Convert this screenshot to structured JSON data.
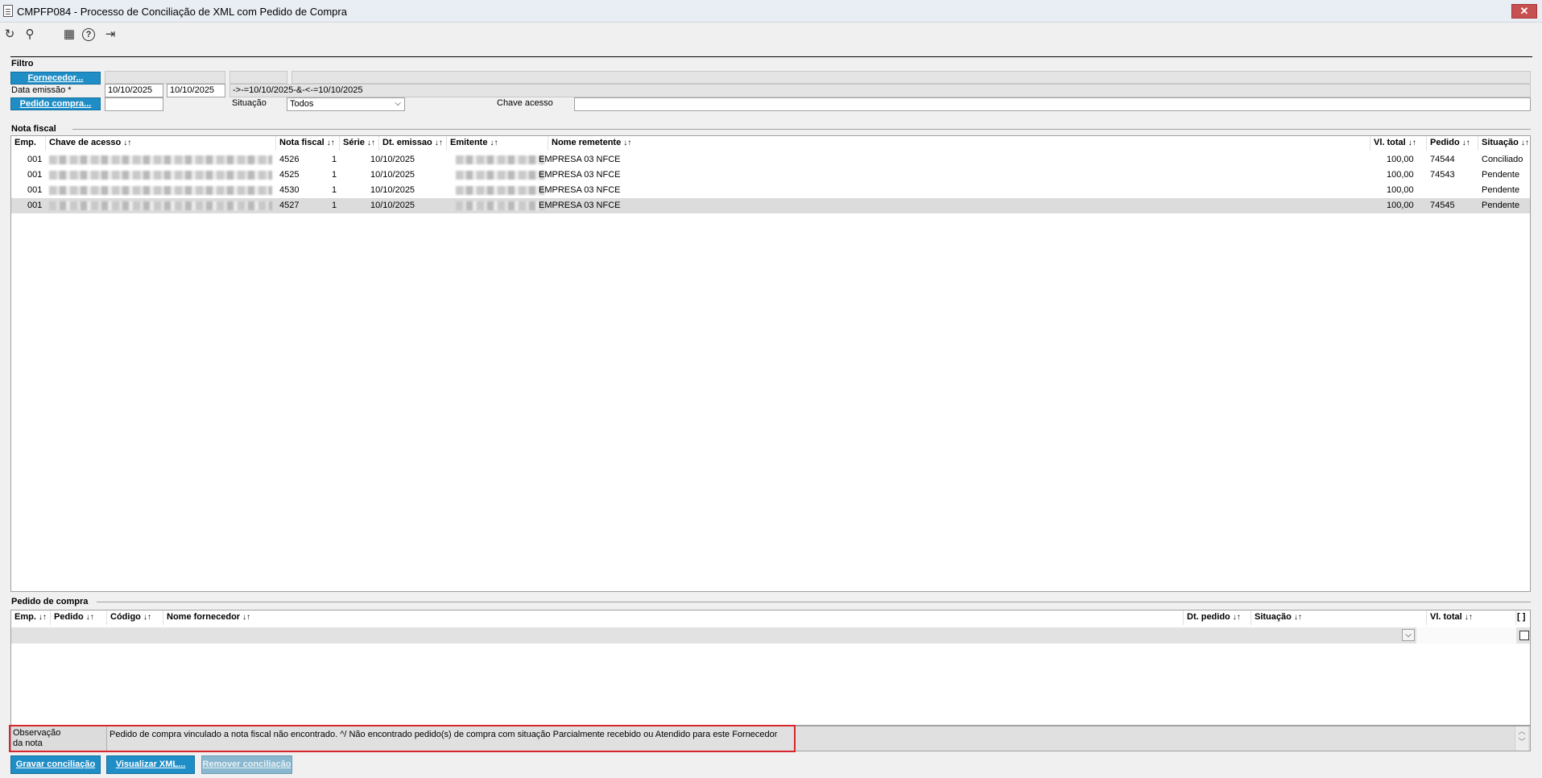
{
  "window": {
    "title": "CMPFP084 - Processo de Conciliação de XML com Pedido de Compra",
    "close_label": "✕"
  },
  "toolbar": {
    "icons": [
      "refresh-icon",
      "search-icon",
      "calendar-icon",
      "help-icon",
      "exit-icon"
    ],
    "glyphs": [
      "↻",
      "⚲",
      "▦",
      "?",
      "⇥"
    ]
  },
  "filtro": {
    "section_label": "Filtro",
    "fornecedor_button": "Fornecedor...",
    "data_emissao_label": "Data emissão *",
    "data_inicio": "10/10/2025",
    "data_fim": "10/10/2025",
    "date_expression": "->-=10/10/2025-&-<-=10/10/2025",
    "pedido_button": "Pedido compra...",
    "situacao_label": "Situação",
    "situacao_value": "Todos",
    "chave_label": "Chave acesso"
  },
  "nota_fiscal": {
    "section_label": "Nota fiscal",
    "sort_glyph": "↓↑",
    "columns": [
      "Emp.",
      "Chave de acesso",
      "Nota fiscal",
      "Série",
      "Dt. emissao",
      "Emitente",
      "Nome remetente",
      "Vl. total",
      "Pedido",
      "Situação"
    ],
    "rows": [
      {
        "emp": "001",
        "nota": "4526",
        "serie": "1",
        "dt": "10/10/2025",
        "nome": "EMPRESA 03 NFCE",
        "vl": "100,00",
        "pedido": "74544",
        "situacao": "Conciliado"
      },
      {
        "emp": "001",
        "nota": "4525",
        "serie": "1",
        "dt": "10/10/2025",
        "nome": "EMPRESA 03 NFCE",
        "vl": "100,00",
        "pedido": "74543",
        "situacao": "Pendente"
      },
      {
        "emp": "001",
        "nota": "4530",
        "serie": "1",
        "dt": "10/10/2025",
        "nome": "EMPRESA 03 NFCE",
        "vl": "100,00",
        "pedido": "",
        "situacao": "Pendente"
      },
      {
        "emp": "001",
        "nota": "4527",
        "serie": "1",
        "dt": "10/10/2025",
        "nome": "EMPRESA 03 NFCE",
        "vl": "100,00",
        "pedido": "74545",
        "situacao": "Pendente"
      }
    ]
  },
  "pedido_compra": {
    "section_label": "Pedido de compra",
    "columns": [
      "Emp.",
      "Pedido",
      "Código",
      "Nome fornecedor",
      "Dt. pedido",
      "Situação",
      "Vl. total",
      "[ ]"
    ]
  },
  "observacao": {
    "label_line1": "Observação",
    "label_line2": "da nota",
    "text": "Pedido de compra vinculado a nota fiscal não encontrado. ^/ Não encontrado pedido(s) de compra com situação Parcialmente recebido ou Atendido para este Fornecedor"
  },
  "actions": {
    "gravar": "Gravar conciliação",
    "visualizar": "Visualizar XML...",
    "remover": "Remover conciliação"
  }
}
